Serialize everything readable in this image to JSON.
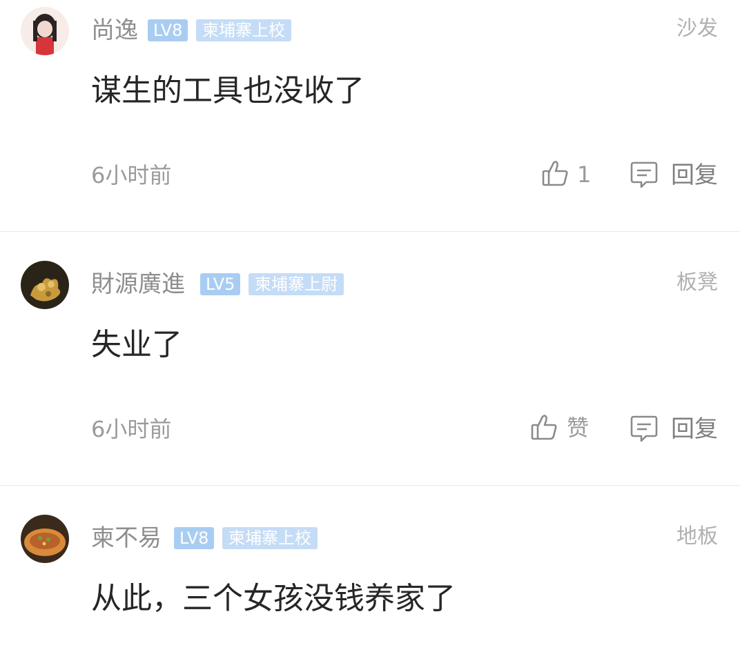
{
  "comments": [
    {
      "username": "尚逸",
      "level": "LV8",
      "title": "柬埔寨上校",
      "floor": "沙发",
      "text": "谋生的工具也没收了",
      "time": "6小时前",
      "like_label": "1",
      "reply_label": "回复",
      "avatar_colors": [
        "#f2d9d0",
        "#d8353a",
        "#2b2222"
      ]
    },
    {
      "username": "財源廣進",
      "level": "LV5",
      "title": "柬埔寨上尉",
      "floor": "板凳",
      "text": "失业了",
      "time": "6小时前",
      "like_label": "赞",
      "reply_label": "回复",
      "avatar_colors": [
        "#2a2418",
        "#c99a3c",
        "#e3c06a"
      ]
    },
    {
      "username": "柬不易",
      "level": "LV8",
      "title": "柬埔寨上校",
      "floor": "地板",
      "text": "从此，三个女孩没钱养家了"
    }
  ],
  "colors": {
    "level_badge": "#a9cdf2",
    "title_badge": "#c4dcf6",
    "divider": "#e9e9e9"
  }
}
